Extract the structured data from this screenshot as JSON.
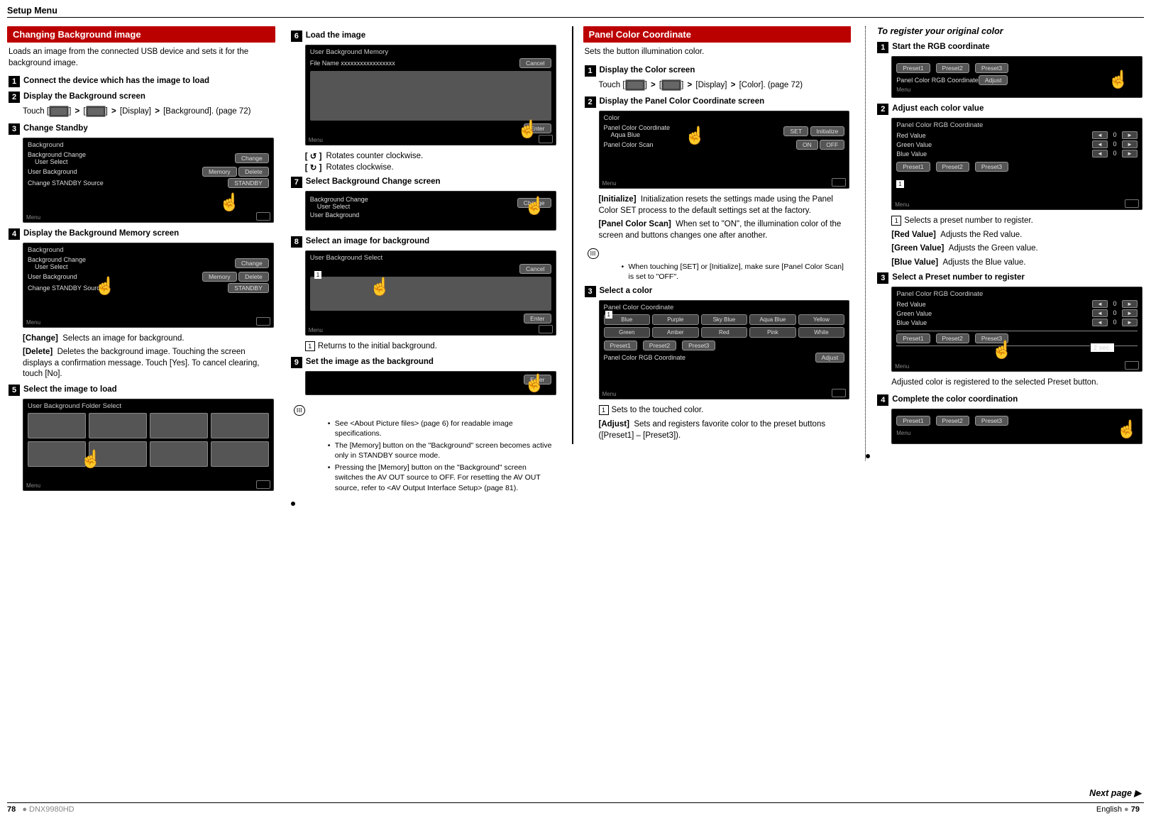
{
  "header": "Setup Menu",
  "footer": {
    "left_page": "78",
    "model": "DNX9980HD",
    "lang": "English",
    "right_page": "79",
    "next": "Next page ▶"
  },
  "col1": {
    "section_title": "Changing Background image",
    "intro": "Loads an image from the connected USB device and sets it for the background image.",
    "s1": "Connect the device which has the image to load",
    "s2": "Display the Background screen",
    "s2_body_pre": "Touch [",
    "s2_body_mid1": "] ",
    "s2_body_mid2": " [",
    "s2_body_mid3": "] ",
    "s2_body_mid4": " [Display] ",
    "s2_body_end": " [Background]. (page 72)",
    "s3": "Change Standby",
    "ss3": {
      "title": "Background",
      "r1a": "Background Change",
      "r1b": "User Select",
      "btn_change": "Change",
      "r2": "User Background",
      "btn_mem": "Memory",
      "btn_del": "Delete",
      "r3": "Change STANDBY Source",
      "btn_stby": "STANDBY",
      "menu": "Menu"
    },
    "s4": "Display the Background Memory screen",
    "def_change_lbl": "[Change]",
    "def_change": "Selects an image for background.",
    "def_delete_lbl": "[Delete]",
    "def_delete": "Deletes the background image. Touching the screen displays a confirmation message. Touch [Yes]. To cancel clearing, touch [No].",
    "s5": "Select the image to load",
    "ss5_title": "User Background Folder Select"
  },
  "col2": {
    "s6": "Load the image",
    "ss6": {
      "title": "User Background Memory",
      "file": "File Name xxxxxxxxxxxxxxxxx",
      "cancel": "Cancel",
      "enter": "Enter",
      "menu": "Menu"
    },
    "rot_ccw_lbl": "[ ↺ ]",
    "rot_ccw": "Rotates counter clockwise.",
    "rot_cw_lbl": "[ ↻ ]",
    "rot_cw": "Rotates clockwise.",
    "s7": "Select Background Change screen",
    "ss7": {
      "r1": "Background Change",
      "r1b": "User Select",
      "btn": "Change",
      "r2": "User Background"
    },
    "s8": "Select an image for background",
    "ss8": {
      "title": "User Background Select",
      "cancel": "Cancel",
      "enter": "Enter",
      "menu": "Menu"
    },
    "idx1": "Returns to the initial background.",
    "s9": "Set the image as the background",
    "ss9_enter": "Enter",
    "note1": "See <About Picture files> (page 6) for readable image specifications.",
    "note2": "The [Memory] button on the \"Background\" screen becomes active only in STANDBY source mode.",
    "note3": "Pressing the [Memory] button on the \"Background\" screen switches the AV OUT source to OFF. For resetting the AV OUT source, refer to <AV Output Interface Setup> (page 81)."
  },
  "col3": {
    "section_title": "Panel Color Coordinate",
    "intro": "Sets the button illumination color.",
    "s1": "Display the Color screen",
    "s1_body_pre": "Touch [",
    "s1_body_mid1": "] ",
    "s1_body_mid2": " [",
    "s1_body_mid3": "] ",
    "s1_body_mid4": " [Display] ",
    "s1_body_end": " [Color]. (page 72)",
    "s2": "Display the Panel Color Coordinate screen",
    "ss2": {
      "title": "Color",
      "r1": "Panel Color Coordinate",
      "r1v": "Aqua Blue",
      "btn_set": "SET",
      "btn_init": "Initialize",
      "r2": "Panel Color Scan",
      "on": "ON",
      "off": "OFF",
      "menu": "Menu"
    },
    "def_init_lbl": "[Initialize]",
    "def_init": "Initialization resets the settings made using the Panel Color SET process to the default settings set at the factory.",
    "def_scan_lbl": "[Panel Color Scan]",
    "def_scan": "When set to \"ON\", the illumination color of the screen and buttons changes one after another.",
    "note": "When touching [SET] or [Initialize], make sure [Panel Color Scan] is set to \"OFF\".",
    "s3": "Select a color",
    "ss3": {
      "title": "Panel Color Coordinate",
      "colors": [
        "Blue",
        "Purple",
        "Sky Blue",
        "Aqua Blue",
        "Yellow",
        "Green",
        "Amber",
        "Red",
        "Pink",
        "White"
      ],
      "p1": "Preset1",
      "p2": "Preset2",
      "p3": "Preset3",
      "rgb": "Panel Color RGB Coordinate",
      "adjust": "Adjust",
      "menu": "Menu"
    },
    "idx1": "Sets to the touched color.",
    "def_adj_lbl": "[Adjust]",
    "def_adj": "Sets and registers favorite color to the preset buttons ([Preset1] – [Preset3])."
  },
  "col4": {
    "italic": "To register your original color",
    "s1": "Start the RGB coordinate",
    "ss1": {
      "p1": "Preset1",
      "p2": "Preset2",
      "p3": "Preset3",
      "rgb": "Panel Color RGB Coordinate",
      "adjust": "Adjust",
      "menu": "Menu"
    },
    "s2": "Adjust each color value",
    "ss2": {
      "title": "Panel Color RGB Coordinate",
      "red": "Red Value",
      "green": "Green Value",
      "blue": "Blue Value",
      "p1": "Preset1",
      "p2": "Preset2",
      "p3": "Preset3",
      "val": "0",
      "menu": "Menu"
    },
    "idx1": "Selects a preset number to register.",
    "def_r_lbl": "[Red Value]",
    "def_r": "Adjusts the Red value.",
    "def_g_lbl": "[Green Value]",
    "def_g": "Adjusts the Green value.",
    "def_b_lbl": "[Blue Value]",
    "def_b": "Adjusts the Blue value.",
    "s3": "Select a Preset number to register",
    "twosec": "2 sec.",
    "reg_note": "Adjusted color is registered to the selected Preset button.",
    "s4": "Complete the color coordination"
  }
}
